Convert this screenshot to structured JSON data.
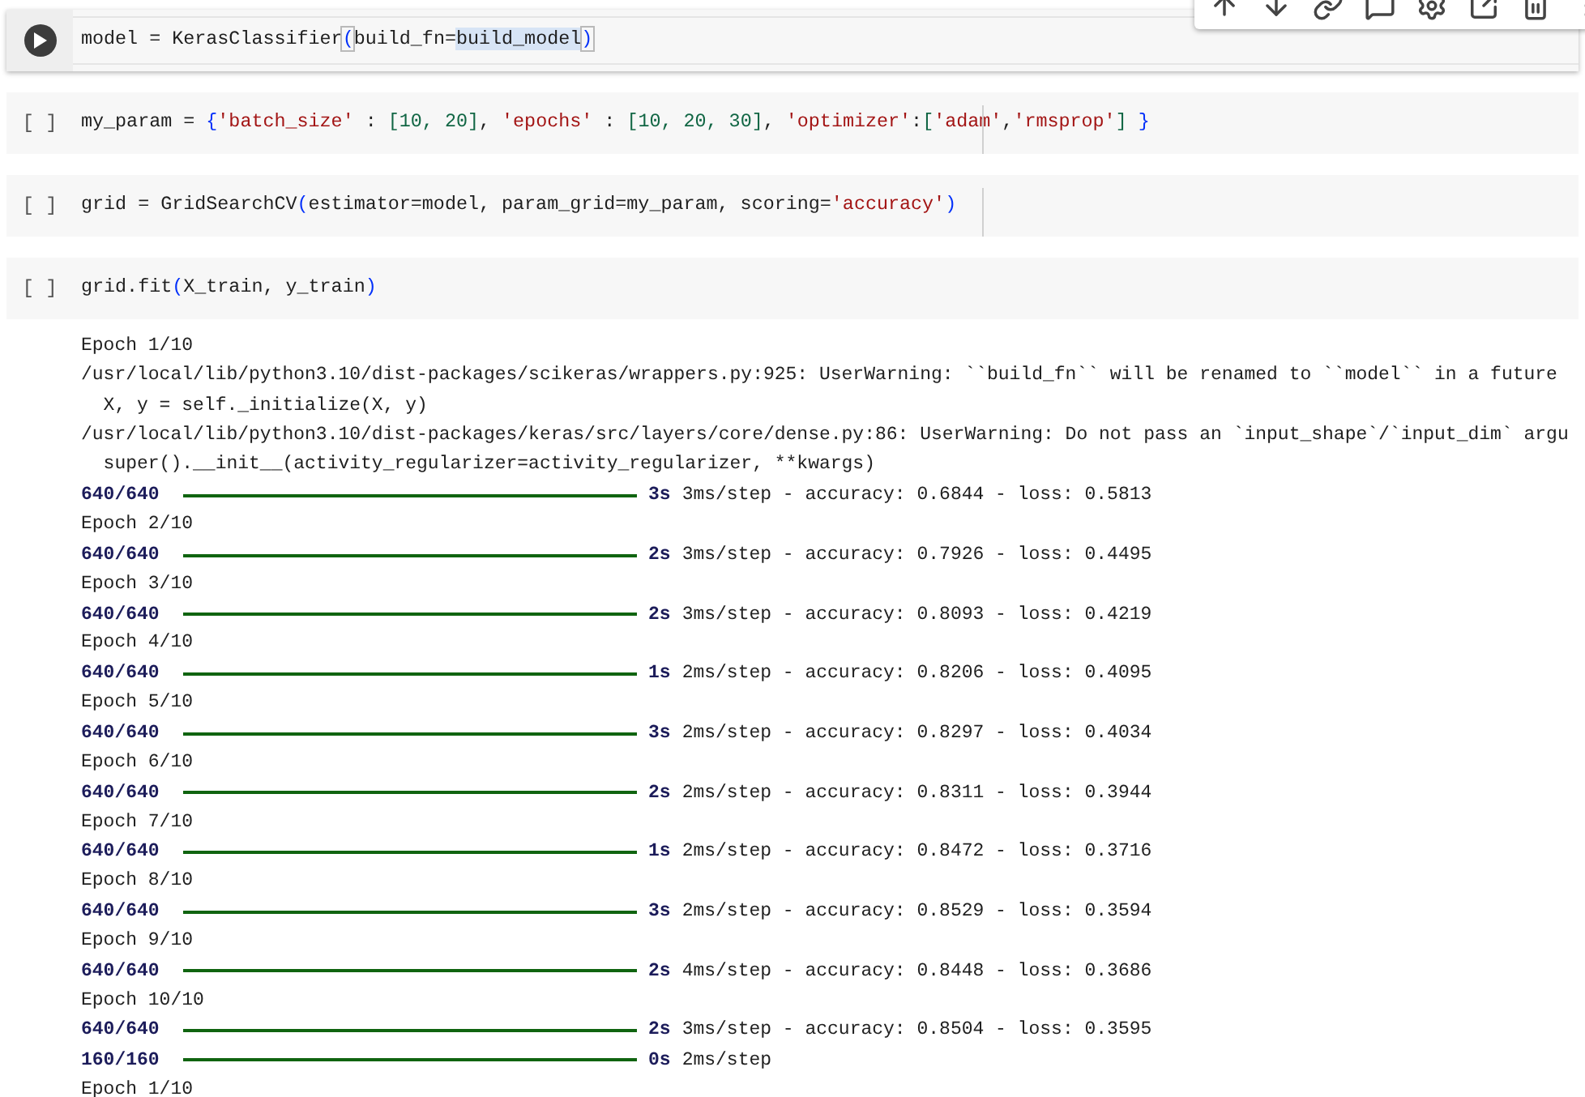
{
  "cells": [
    {
      "kind": "active",
      "tokens": [
        {
          "t": "model = KerasClassifier",
          "kind": "plain"
        },
        {
          "t": "(",
          "kind": "match"
        },
        {
          "t": "build_fn=",
          "kind": "plain"
        },
        {
          "t": "build_model",
          "kind": "selected"
        },
        {
          "t": ")",
          "kind": "match"
        }
      ]
    },
    {
      "kind": "idle",
      "run_label": "[ ]",
      "tokens": [
        {
          "t": "my_param = ",
          "kind": "plain"
        },
        {
          "t": "{",
          "kind": "bracket"
        },
        {
          "t": "'batch_size'",
          "kind": "string"
        },
        {
          "t": " : ",
          "kind": "plain"
        },
        {
          "t": "[10, 20]",
          "kind": "number"
        },
        {
          "t": ", ",
          "kind": "plain"
        },
        {
          "t": "'epochs'",
          "kind": "string"
        },
        {
          "t": " : ",
          "kind": "plain"
        },
        {
          "t": "[10, 20, 30]",
          "kind": "number"
        },
        {
          "t": ", ",
          "kind": "plain"
        },
        {
          "t": "'optimizer'",
          "kind": "string"
        },
        {
          "t": ":",
          "kind": "plain"
        },
        {
          "t": "[",
          "kind": "number"
        },
        {
          "t": "'adam'",
          "kind": "string"
        },
        {
          "t": ",",
          "kind": "plain"
        },
        {
          "t": "'rmsprop'",
          "kind": "string"
        },
        {
          "t": "]",
          "kind": "number"
        },
        {
          "t": " }",
          "kind": "bracket"
        }
      ]
    },
    {
      "kind": "idle",
      "run_label": "[ ]",
      "tokens": [
        {
          "t": "grid = GridSearchCV",
          "kind": "plain"
        },
        {
          "t": "(",
          "kind": "bracket"
        },
        {
          "t": "estimator=model, param_grid=my_param, scoring=",
          "kind": "plain"
        },
        {
          "t": "'accuracy'",
          "kind": "string"
        },
        {
          "t": ")",
          "kind": "bracket"
        }
      ]
    },
    {
      "kind": "idle",
      "run_label": "[ ]",
      "tokens": [
        {
          "t": "grid.fit",
          "kind": "plain"
        },
        {
          "t": "(",
          "kind": "bracket"
        },
        {
          "t": "X_train, y_train",
          "kind": "plain"
        },
        {
          "t": ")",
          "kind": "bracket"
        }
      ]
    }
  ],
  "output": [
    {
      "kind": "text",
      "text": "Epoch 1/10"
    },
    {
      "kind": "text",
      "text": "/usr/local/lib/python3.10/dist-packages/scikeras/wrappers.py:925: UserWarning: ``build_fn`` will be renamed to ``model`` in a future"
    },
    {
      "kind": "text",
      "text": "  X, y = self._initialize(X, y)"
    },
    {
      "kind": "text",
      "text": "/usr/local/lib/python3.10/dist-packages/keras/src/layers/core/dense.py:86: UserWarning: Do not pass an `input_shape`/`input_dim` argu"
    },
    {
      "kind": "text",
      "text": "  super().__init__(activity_regularizer=activity_regularizer, **kwargs)"
    },
    {
      "kind": "progress",
      "step": "640/640",
      "level": 1,
      "time": "3s",
      "rest": "3ms/step - accuracy: 0.6844 - loss: 0.5813"
    },
    {
      "kind": "text",
      "text": "Epoch 2/10"
    },
    {
      "kind": "progress",
      "step": "640/640",
      "level": 1,
      "time": "2s",
      "rest": "3ms/step - accuracy: 0.7926 - loss: 0.4495"
    },
    {
      "kind": "text",
      "text": "Epoch 3/10"
    },
    {
      "kind": "progress",
      "step": "640/640",
      "level": 1,
      "time": "2s",
      "rest": "3ms/step - accuracy: 0.8093 - loss: 0.4219"
    },
    {
      "kind": "text",
      "text": "Epoch 4/10"
    },
    {
      "kind": "progress",
      "step": "640/640",
      "level": 1,
      "time": "1s",
      "rest": "2ms/step - accuracy: 0.8206 - loss: 0.4095"
    },
    {
      "kind": "text",
      "text": "Epoch 5/10"
    },
    {
      "kind": "progress",
      "step": "640/640",
      "level": 1,
      "time": "3s",
      "rest": "2ms/step - accuracy: 0.8297 - loss: 0.4034"
    },
    {
      "kind": "text",
      "text": "Epoch 6/10"
    },
    {
      "kind": "progress",
      "step": "640/640",
      "level": 1,
      "time": "2s",
      "rest": "2ms/step - accuracy: 0.8311 - loss: 0.3944"
    },
    {
      "kind": "text",
      "text": "Epoch 7/10"
    },
    {
      "kind": "progress",
      "step": "640/640",
      "level": 1,
      "time": "1s",
      "rest": "2ms/step - accuracy: 0.8472 - loss: 0.3716"
    },
    {
      "kind": "text",
      "text": "Epoch 8/10"
    },
    {
      "kind": "progress",
      "step": "640/640",
      "level": 1,
      "time": "3s",
      "rest": "2ms/step - accuracy: 0.8529 - loss: 0.3594"
    },
    {
      "kind": "text",
      "text": "Epoch 9/10"
    },
    {
      "kind": "progress",
      "step": "640/640",
      "level": 1,
      "time": "2s",
      "rest": "4ms/step - accuracy: 0.8448 - loss: 0.3686"
    },
    {
      "kind": "text",
      "text": "Epoch 10/10"
    },
    {
      "kind": "progress",
      "step": "640/640",
      "level": 1,
      "time": "2s",
      "rest": "3ms/step - accuracy: 0.8504 - loss: 0.3595"
    },
    {
      "kind": "progress",
      "step": "160/160",
      "level": 1,
      "time": "0s",
      "rest": "2ms/step"
    },
    {
      "kind": "text",
      "text": "Epoch 1/10"
    }
  ]
}
